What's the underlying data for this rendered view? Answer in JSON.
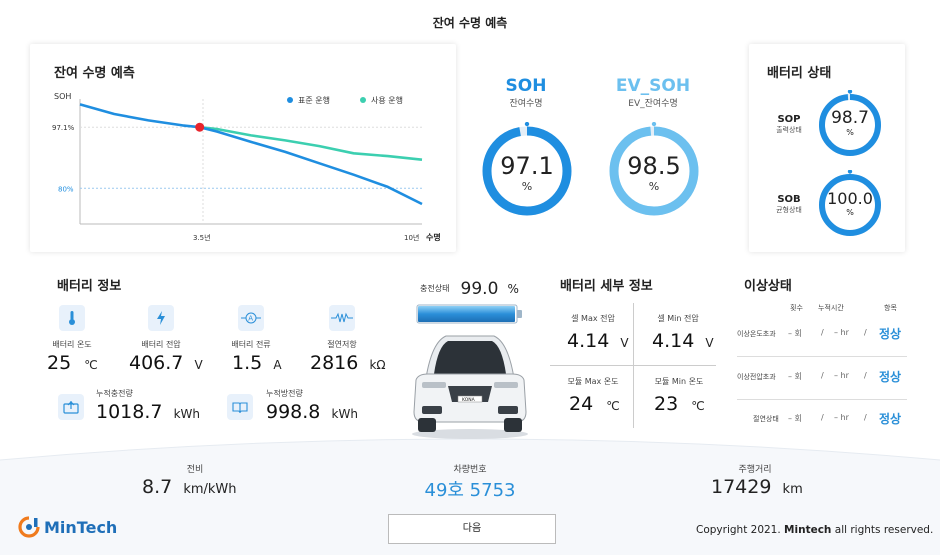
{
  "page_title": "잔여 수명 예측",
  "chart_card": {
    "title": "잔여 수명 예측",
    "y_label": "SOH",
    "y_tick_1": "97.1%",
    "y_tick_2": "80%",
    "x_tick_1": "3.5년",
    "x_tick_2": "10년",
    "x_label": "수명",
    "legend_1": "표준 운행",
    "legend_2": "사용 운행"
  },
  "chart_data": {
    "type": "line",
    "xlabel": "수명",
    "ylabel": "SOH",
    "x": [
      0,
      1,
      2,
      3,
      3.5,
      4,
      5,
      6,
      7,
      8,
      9,
      10
    ],
    "series": [
      {
        "name": "표준 운행",
        "color": "#1f8ee0",
        "values": [
          103.5,
          100.8,
          99.0,
          97.6,
          97.1,
          95.9,
          93.0,
          90.2,
          87.0,
          83.8,
          80.4,
          75.6
        ]
      },
      {
        "name": "사용 운행",
        "color": "#3ccfb0",
        "values": [
          null,
          null,
          null,
          null,
          97.1,
          96.6,
          94.8,
          93.4,
          91.8,
          89.8,
          89.0,
          88.0
        ]
      }
    ],
    "marker": {
      "x": 3.5,
      "y": 97.1
    },
    "reference_lines": [
      97.1,
      80
    ],
    "xlim": [
      0,
      10
    ],
    "ylim": [
      70,
      105
    ],
    "grid": false
  },
  "soh": {
    "title": "SOH",
    "sub": "잔여수명",
    "value": "97.1",
    "pct": "%",
    "fraction": 0.971,
    "color": "#1f8ee0"
  },
  "ev_soh": {
    "title": "EV_SOH",
    "sub": "EV_잔여수명",
    "value": "98.5",
    "pct": "%",
    "fraction": 0.985,
    "color": "#6cc0ef"
  },
  "status_card": {
    "title": "배터리 상태",
    "sop": {
      "label": "SOP",
      "sub": "출력상태",
      "value": "98.7",
      "pct": "%",
      "fraction": 0.987
    },
    "sob": {
      "label": "SOB",
      "sub": "균형상태",
      "value": "100.0",
      "pct": "%",
      "fraction": 1.0
    }
  },
  "battery_info": {
    "title": "배터리 정보",
    "items": [
      {
        "label": "배터리 온도",
        "value": "25",
        "unit": "℃",
        "icon": "thermometer-icon"
      },
      {
        "label": "배터리 전압",
        "value": "406.7",
        "unit": "V",
        "icon": "bolt-icon"
      },
      {
        "label": "배터리 전류",
        "value": "1.5",
        "unit": "A",
        "icon": "ammeter-icon"
      },
      {
        "label": "절연저항",
        "value": "2816",
        "unit": "kΩ",
        "icon": "resistor-icon"
      }
    ],
    "cumulative": [
      {
        "label": "누적충전량",
        "value": "1018.7",
        "unit": "kWh",
        "icon": "charge-in-icon"
      },
      {
        "label": "누적방전량",
        "value": "998.8",
        "unit": "kWh",
        "icon": "book-icon"
      }
    ]
  },
  "charge": {
    "label": "충전상태",
    "value": "99.0",
    "unit": "%",
    "fraction": 0.99
  },
  "car_plate_badge": "KONA",
  "detail": {
    "title": "배터리 세부 정보",
    "cells": [
      {
        "label": "셀 Max 전압",
        "value": "4.14",
        "unit": "V"
      },
      {
        "label": "셀 Min 전압",
        "value": "4.14",
        "unit": "V"
      },
      {
        "label": "모듈 Max 온도",
        "value": "24",
        "unit": "℃"
      },
      {
        "label": "모듈 Min 온도",
        "value": "23",
        "unit": "℃"
      }
    ]
  },
  "anomaly": {
    "title": "이상상태",
    "headers": [
      "횟수",
      "누적시간",
      "항목"
    ],
    "rows": [
      {
        "label": "이상온도초과",
        "count": "– 회",
        "sep1": "/",
        "time": "– hr",
        "sep2": "/",
        "state": "정상"
      },
      {
        "label": "이상전압초과",
        "count": "– 회",
        "sep1": "/",
        "time": "– hr",
        "sep2": "/",
        "state": "정상"
      },
      {
        "label": "절연상태",
        "count": "– 회",
        "sep1": "/",
        "time": "– hr",
        "sep2": "/",
        "state": "정상"
      }
    ]
  },
  "footer": {
    "efficiency": {
      "label": "전비",
      "value": "8.7",
      "unit": "km/kWh"
    },
    "plate": {
      "label": "차량번호",
      "value": "49호 5753"
    },
    "distance": {
      "label": "주행거리",
      "value": "17429",
      "unit": "km"
    },
    "next_button": "다음",
    "logo_text": "MinTech",
    "copyright_prefix": "Copyright 2021. ",
    "copyright_brand": "Mintech",
    "copyright_suffix": " all rights reserved."
  },
  "colors": {
    "accent": "#1f8ee0",
    "teal": "#3ccfb0",
    "light_blue": "#6cc0ef",
    "logo_orange": "#f07b1d",
    "logo_blue": "#1f6fb8"
  }
}
